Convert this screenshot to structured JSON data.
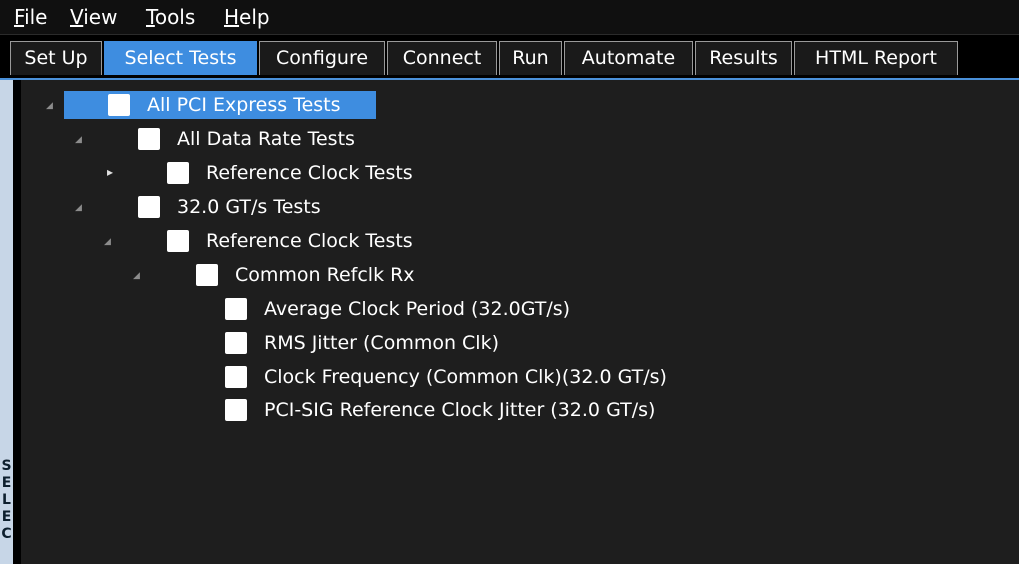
{
  "menu": {
    "file": {
      "accel": "F",
      "rest": "ile"
    },
    "view": {
      "accel": "V",
      "rest": "iew"
    },
    "tools": {
      "accel": "T",
      "rest": "ools"
    },
    "help": {
      "accel": "H",
      "rest": "elp"
    }
  },
  "tabs": {
    "setup": "Set Up",
    "select_tests": "Select Tests",
    "configure": "Configure",
    "connect": "Connect",
    "run": "Run",
    "automate": "Automate",
    "results": "Results",
    "html_report": "HTML Report"
  },
  "side_panel": {
    "letters": [
      "S",
      "E",
      "L",
      "E",
      "C"
    ]
  },
  "tree": {
    "all_pci": "All PCI Express Tests",
    "all_data_rate": "All Data Rate Tests",
    "ref_clock_1": "Reference Clock Tests",
    "gts_32": "32.0 GT/s Tests",
    "ref_clock_2": "Reference Clock Tests",
    "common_refclk": "Common Refclk Rx",
    "avg_clock_period": "Average Clock Period (32.0GT/s)",
    "rms_jitter": "RMS Jitter (Common Clk)",
    "clock_freq": "Clock Frequency (Common Clk)(32.0 GT/s)",
    "pci_sig_jitter": "PCI-SIG Reference Clock Jitter (32.0 GT/s)"
  }
}
